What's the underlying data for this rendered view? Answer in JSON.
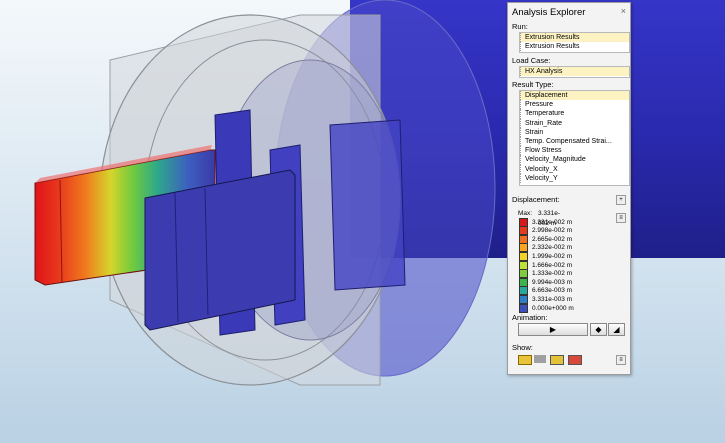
{
  "panel": {
    "title": "Analysis Explorer",
    "close": "×",
    "run_label": "Run:",
    "runs": [
      {
        "label": "Extrusion Results",
        "selected": true
      },
      {
        "label": "Extrusion Results",
        "selected": false
      }
    ],
    "load_case_label": "Load Case:",
    "load_case": "HX Analysis",
    "result_type_label": "Result Type:",
    "result_types": [
      "Displacement",
      "Pressure",
      "Temperature",
      "Strain_Rate",
      "Strain",
      "Temp. Compensated Strai...",
      "Flow Stress",
      "Velocity_Magnitude",
      "Velocity_X",
      "Velocity_Y"
    ],
    "displacement_label": "Displacement:",
    "legend": {
      "max_label": "Max:",
      "values": [
        "3.331e-002 m",
        "3.331e-002 m",
        "2.998e-002 m",
        "2.665e-002 m",
        "2.332e-002 m",
        "1.999e-002 m",
        "1.666e-002 m",
        "1.333e-002 m",
        "9.994e-003 m",
        "6.663e-003 m",
        "3.331e-003 m",
        "0.000e+000 m"
      ],
      "colors": [
        "#d7191c",
        "#e53a1e",
        "#f0701f",
        "#f6a623",
        "#f3d32a",
        "#bfe03a",
        "#7fcd3e",
        "#3bb54a",
        "#27a89a",
        "#2b7fc4",
        "#3a4fb8",
        "#2c2c8a"
      ]
    },
    "animation_label": "Animation:",
    "play_icon": "▶",
    "show_label": "Show:",
    "accent": "#fdf3c2"
  }
}
